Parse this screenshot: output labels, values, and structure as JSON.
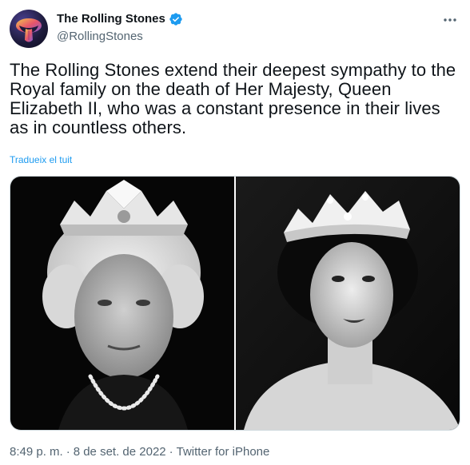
{
  "author": {
    "display_name": "The Rolling Stones",
    "handle": "@RollingStones",
    "verified": true,
    "avatar_icon": "rolling-stones-tongue-logo"
  },
  "tweet": {
    "text": "The Rolling Stones extend their deepest sympathy to the Royal family on the death of Her Majesty, Queen Elizabeth II, who was a constant presence in their lives as in countless others.",
    "translate_label": "Tradueix el tuit"
  },
  "media": {
    "count": 2,
    "photos": [
      {
        "kind": "black-and-white portrait"
      },
      {
        "kind": "black-and-white portrait"
      }
    ]
  },
  "meta": {
    "time": "8:49 p. m.",
    "separator": "·",
    "date": "8 de set. de 2022",
    "source": "Twitter for iPhone"
  },
  "colors": {
    "accent": "#1d9bf0",
    "text_primary": "#0f1419",
    "text_secondary": "#536471",
    "border": "#cfd9de"
  }
}
